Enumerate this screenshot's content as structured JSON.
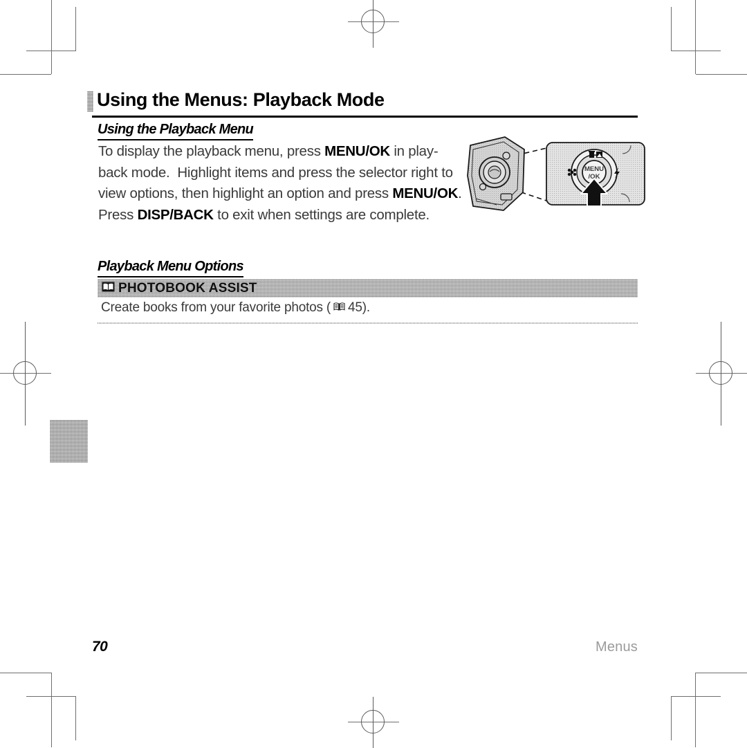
{
  "page": {
    "title": "Using the Menus: Playback Mode",
    "folio": "70",
    "running_head": "Menus"
  },
  "sections": [
    {
      "heading": "Using the Playback Menu",
      "paragraph_parts": [
        {
          "text": "To display the playback menu, press ",
          "bold": false
        },
        {
          "text": "MENU/OK",
          "bold": true
        },
        {
          "text": " in play-back mode.  Highlight items and press the selector right to view options, then highlight an option and press ",
          "bold": false
        },
        {
          "text": "MENU/OK",
          "bold": true
        },
        {
          "text": ".  Press ",
          "bold": false
        },
        {
          "text": "DISP/BACK",
          "bold": true
        },
        {
          "text": " to exit when settings are complete.",
          "bold": false
        }
      ],
      "paragraph_plain": "To display the playback menu, press MENU/OK in playback mode.  Highlight items and press the selector right to view options, then highlight an option and press MENU/OK.  Press DISP/BACK to exit when settings are complete."
    },
    {
      "heading": "Playback Menu Options",
      "options": [
        {
          "icon": "book-icon",
          "label": "PHOTOBOOK ASSIST",
          "description_before": "Create books from your favorite photos (",
          "reference_icon": "book-icon",
          "reference_page": "45",
          "description_after": ")."
        }
      ]
    }
  ],
  "illustration": {
    "name": "camera-selector-illustration",
    "callout_labels": {
      "center_button_line1": "MENU",
      "center_button_line2": "/OK"
    },
    "selector_icons": [
      "trash-icon",
      "exposure-compensation-icon",
      "macro-icon",
      "flash-icon"
    ]
  },
  "print_marks": {
    "registration_marks": 4,
    "corner_trim_marks": 4,
    "thumb_tab": "index-thumb-tab"
  },
  "colors": {
    "band_gray": "#a6a6a6",
    "rule_black": "#000000",
    "running_head_gray": "#9b9b9b",
    "mark_gray": "#6e6e6e"
  }
}
